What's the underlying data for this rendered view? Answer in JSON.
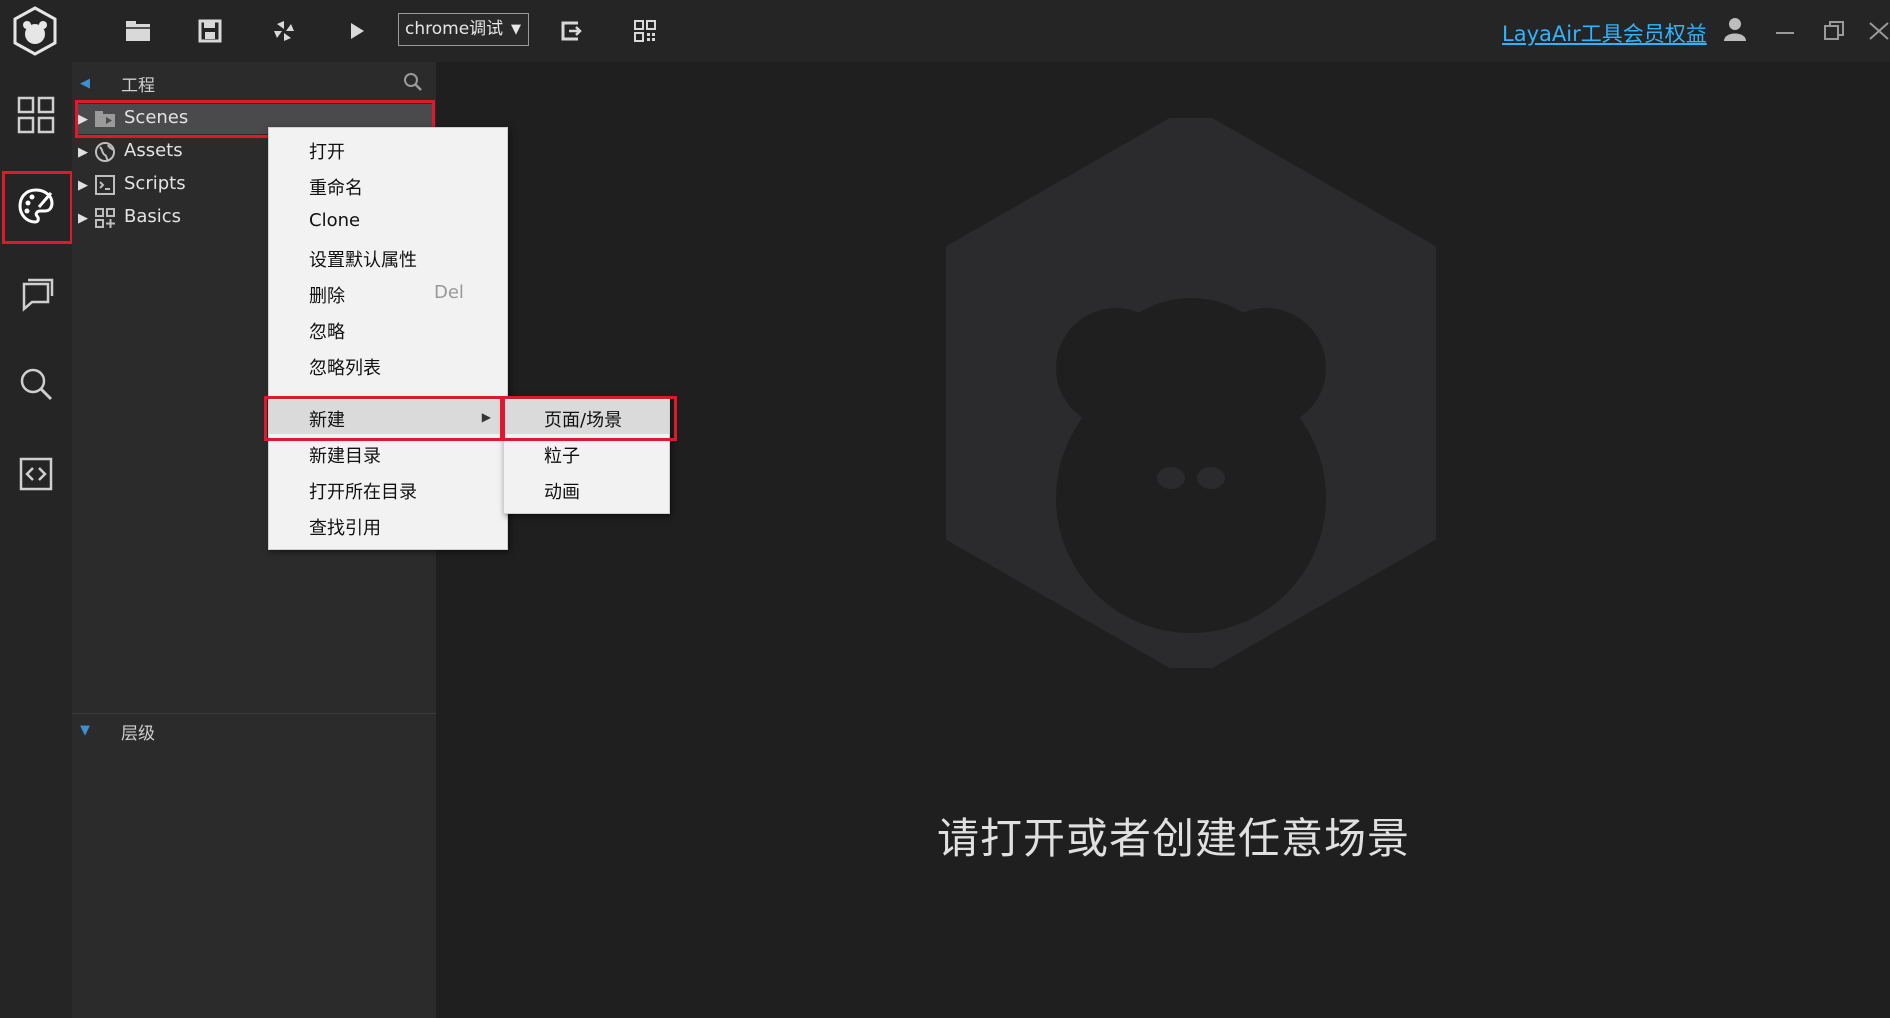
{
  "toolbar": {
    "debug_target": "chrome调试",
    "debug_arrow": "▼",
    "member_link": "LayaAir工具会员权益",
    "icons": [
      "app-logo-icon",
      "open-folder-icon",
      "save-icon",
      "compile-icon",
      "play-icon",
      "export-icon",
      "qrcode-icon",
      "user-icon",
      "minimize-icon",
      "restore-icon",
      "close-icon"
    ]
  },
  "activity_bar": {
    "icons": [
      "layout-grid-icon",
      "palette-icon",
      "comment-icon",
      "search-icon",
      "code-icon"
    ],
    "active": "palette-icon"
  },
  "project_panel": {
    "header": "工程",
    "tree": [
      {
        "label": "Scenes",
        "icon": "scenes-folder-icon"
      },
      {
        "label": "Assets",
        "icon": "globe-icon"
      },
      {
        "label": "Scripts",
        "icon": "script-icon"
      },
      {
        "label": "Basics",
        "icon": "grid-plus-icon"
      }
    ]
  },
  "hierarchy_panel": {
    "header": "层级"
  },
  "main": {
    "empty_message": "请打开或者创建任意场景"
  },
  "context_menu": {
    "items": [
      {
        "label": "打开"
      },
      {
        "label": "重命名"
      },
      {
        "label": "Clone"
      },
      {
        "label": "设置默认属性"
      },
      {
        "label": "删除",
        "shortcut": "Del"
      },
      {
        "label": "忽略"
      },
      {
        "label": "忽略列表"
      },
      {
        "label": "新建",
        "submenu_arrow": "▶"
      },
      {
        "label": "新建目录"
      },
      {
        "label": "打开所在目录"
      },
      {
        "label": "查找引用"
      }
    ]
  },
  "submenu": {
    "items": [
      {
        "label": "页面/场景"
      },
      {
        "label": "粒子"
      },
      {
        "label": "动画"
      }
    ]
  },
  "colors": {
    "highlight_box": "#e0182d",
    "link": "#2fb4ff",
    "background": "#1f1f20"
  }
}
